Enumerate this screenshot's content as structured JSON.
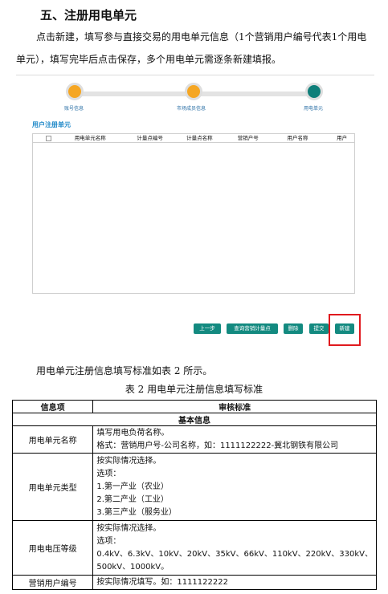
{
  "document": {
    "heading": "五、注册用电单元",
    "intro": "点击新建，填写参与直接交易的用电单元信息（1个营销用户编号代表1个用电单元），填写完毕后点击保存，多个用电单元需逐条新建填报。",
    "table_reference": "用电单元注册信息填写标准如表 2 所示。",
    "table_caption": "表 2  用电单元注册信息填写标准"
  },
  "screenshot": {
    "steps": [
      "账号信息",
      "市场成员信息",
      "用电单元"
    ],
    "panel_title": "用户注册单元",
    "grid_columns": [
      "用电单元名称",
      "计量点编号",
      "计量点名称",
      "营销户号",
      "用户名称",
      "用户"
    ],
    "buttons": [
      "上一步",
      "查询营销计量点",
      "删除",
      "提交",
      "新建"
    ],
    "colors": {
      "step_done": "#f5a623",
      "step_current": "#0f7f7a",
      "button": "#138a80",
      "highlight": "#e0191e"
    }
  },
  "standard_table": {
    "headers": [
      "信息项",
      "审核标准"
    ],
    "section": "基本信息",
    "rows": [
      {
        "item": "用电单元名称",
        "lines": [
          "填写用电负荷名称。",
          "格式：营销用户号-公司名称，如：1111122222-冀北钢铁有限公司"
        ]
      },
      {
        "item": "用电单元类型",
        "lines": [
          "按实际情况选择。",
          "选项：",
          "1.第一产业（农业）",
          "2.第二产业（工业）",
          "3.第三产业（服务业）"
        ]
      },
      {
        "item": "用电电压等级",
        "lines": [
          "按实际情况选择。",
          "选项：",
          "0.4kV、6.3kV、10kV、20kV、35kV、66kV、110kV、220kV、330kV、",
          "500kV、1000kV。"
        ]
      },
      {
        "item": "营销用户编号",
        "lines": [
          "按实际情况填写。如：1111122222"
        ]
      }
    ]
  }
}
